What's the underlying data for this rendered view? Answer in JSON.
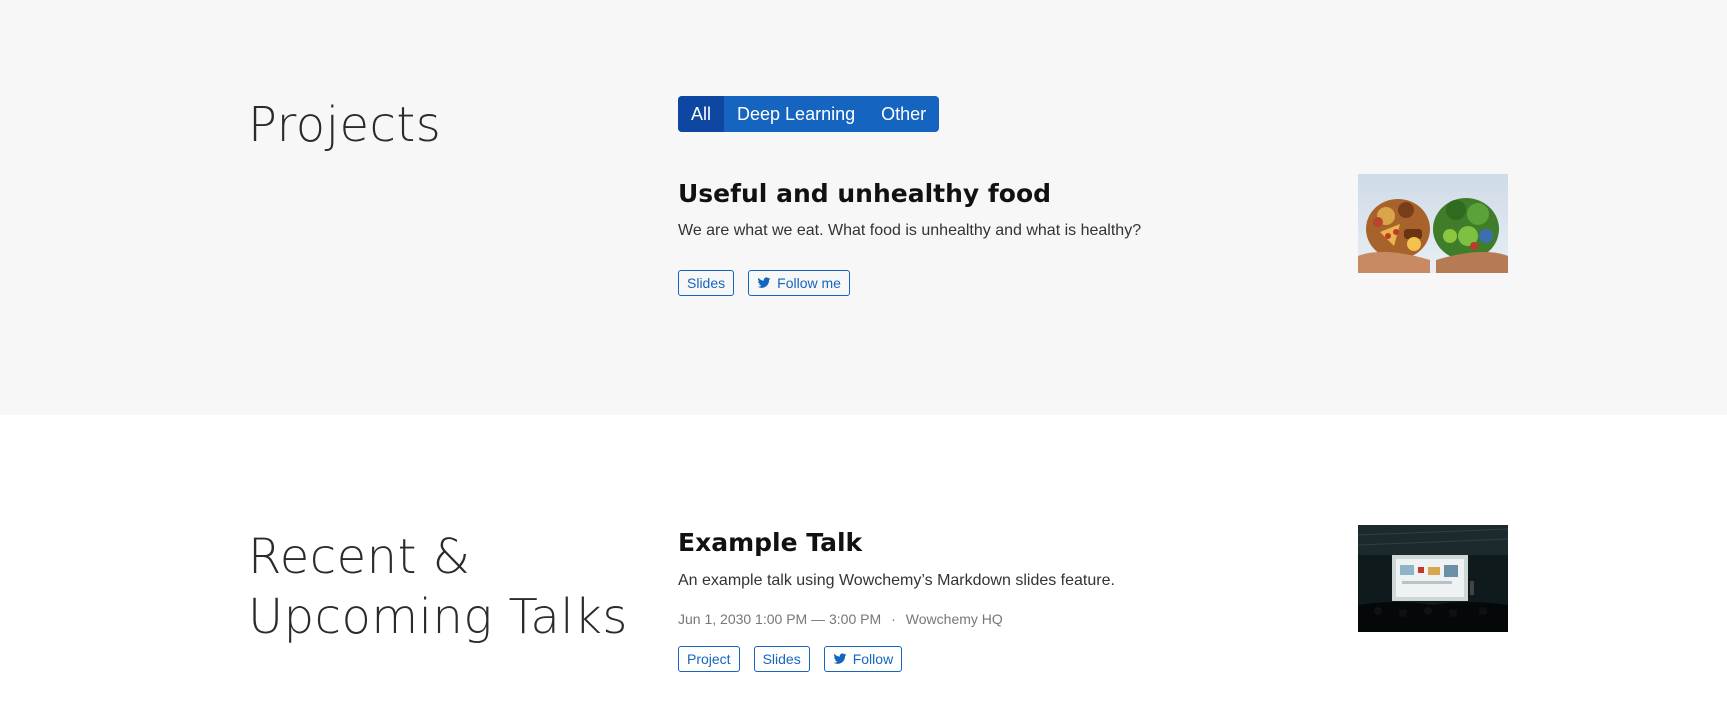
{
  "projects": {
    "title": "Projects",
    "filters": [
      {
        "label": "All",
        "active": true
      },
      {
        "label": "Deep Learning",
        "active": false
      },
      {
        "label": "Other",
        "active": false
      }
    ],
    "item": {
      "title": "Useful and unhealthy food",
      "summary": "We are what we eat. What food is unhealthy and what is healthy?",
      "buttons": [
        {
          "label": "Slides",
          "icon": ""
        },
        {
          "label": "Follow me",
          "icon": "twitter-icon"
        }
      ]
    }
  },
  "talks": {
    "title": "Recent & Upcoming Talks",
    "item": {
      "title": "Example Talk",
      "summary": "An example talk using Wowchemy’s Markdown slides feature.",
      "datetime": "Jun 1, 2030 1:00 PM — 3:00 PM",
      "separator": "·",
      "location": "Wowchemy HQ",
      "buttons": [
        {
          "label": "Project",
          "icon": ""
        },
        {
          "label": "Slides",
          "icon": ""
        },
        {
          "label": "Follow",
          "icon": "twitter-icon"
        }
      ]
    }
  },
  "colors": {
    "accent": "#1565c0",
    "accent_dark": "#0d47a1",
    "section_bg": "#f7f7f7"
  }
}
